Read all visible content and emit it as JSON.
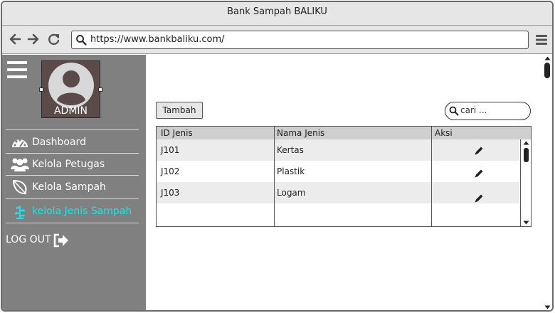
{
  "window": {
    "title": "Bank Sampah BALIKU"
  },
  "browser": {
    "url": "https://www.bankbaliku.com/",
    "back_icon": "back-arrow-icon",
    "forward_icon": "forward-arrow-icon",
    "reload_icon": "reload-icon",
    "menu_icon": "hamburger-menu-icon"
  },
  "sidebar": {
    "role_label": "ADMIN",
    "items": [
      {
        "label": "Dashboard",
        "icon": "dashboard-gauge-icon"
      },
      {
        "label": "Kelola Petugas",
        "icon": "users-group-icon"
      },
      {
        "label": "Kelola Sampah",
        "icon": "leaf-icon"
      },
      {
        "label": "kelola  Jenis Sampah",
        "icon": "plant-icon",
        "active": true
      }
    ],
    "logout_label": "LOG OUT",
    "active_color": "#19e6e6"
  },
  "main": {
    "add_button": "Tambah",
    "search_placeholder": "cari ...",
    "table": {
      "columns": [
        "ID Jenis",
        "Nama Jenis",
        "Aksi"
      ],
      "rows": [
        {
          "id": "J101",
          "name": "Kertas",
          "action_icon": "pencil-edit-icon"
        },
        {
          "id": "J102",
          "name": "Plastik",
          "action_icon": "pencil-edit-icon"
        },
        {
          "id": "J103",
          "name": "Logam",
          "action_icon": "pencil-edit-icon"
        }
      ]
    }
  }
}
